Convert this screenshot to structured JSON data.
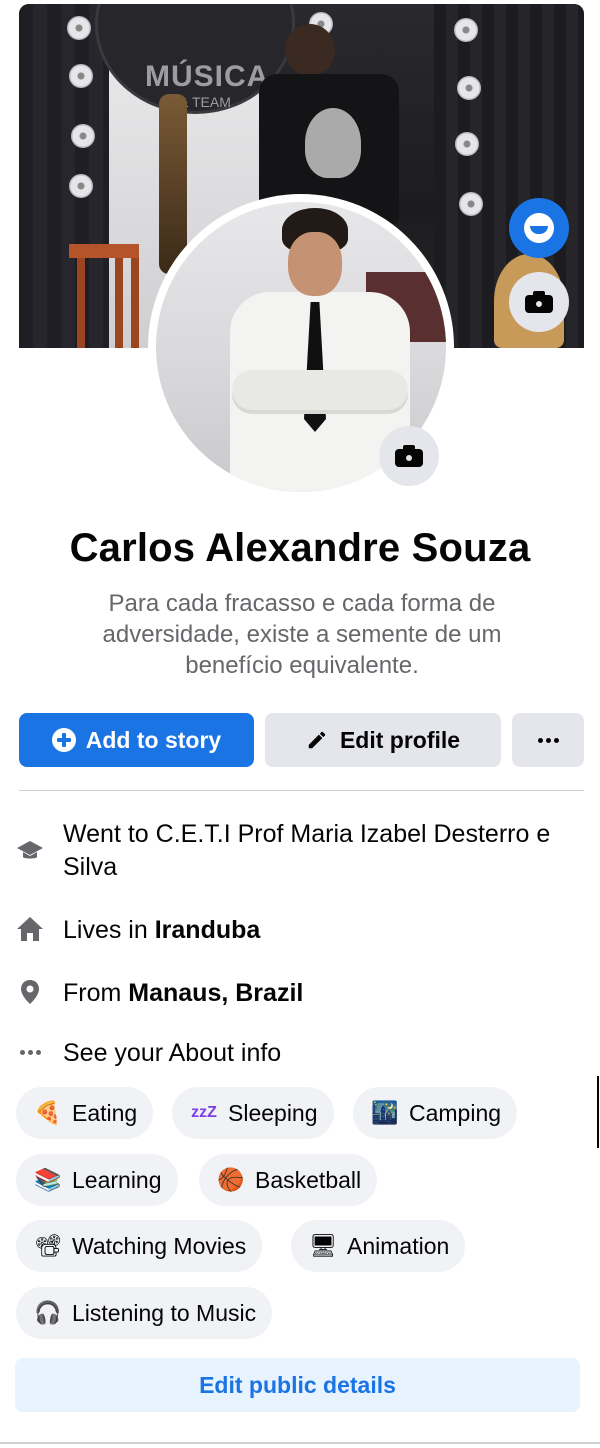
{
  "profile": {
    "name": "Carlos Alexandre Souza",
    "bio": "Para cada fracasso e cada forma de adversidade, existe a semente de um benefício equivalente."
  },
  "cover": {
    "sign_text": "MÚSICA",
    "sign_sub": "& TEAM"
  },
  "actions": {
    "add_to_story": "Add to story",
    "edit_profile": "Edit profile"
  },
  "info": {
    "school": "Went to C.E.T.I Prof Maria Izabel Desterro e Silva",
    "lives_prefix": "Lives in ",
    "lives_place": "Iranduba",
    "from_prefix": "From ",
    "from_place": "Manaus, Brazil",
    "about": "See your About info"
  },
  "hobbies": [
    {
      "label": "Eating",
      "emoji": "🍕"
    },
    {
      "label": "Sleeping",
      "emoji": "zzZ"
    },
    {
      "label": "Camping",
      "emoji": "🌃"
    },
    {
      "label": "Learning",
      "emoji": "📚"
    },
    {
      "label": "Basketball",
      "emoji": "🏀"
    },
    {
      "label": "Watching Movies",
      "emoji": "📽"
    },
    {
      "label": "Animation",
      "emoji": "🖥"
    },
    {
      "label": "Listening to Music",
      "emoji": "🎧"
    }
  ],
  "edit_public_details": "Edit public details",
  "colors": {
    "accent": "#1b74e4",
    "button_gray": "#e4e6eb",
    "secondary_text": "#65676b",
    "chip_bg": "#f0f2f5",
    "light_accent_bg": "#e7f3ff"
  }
}
